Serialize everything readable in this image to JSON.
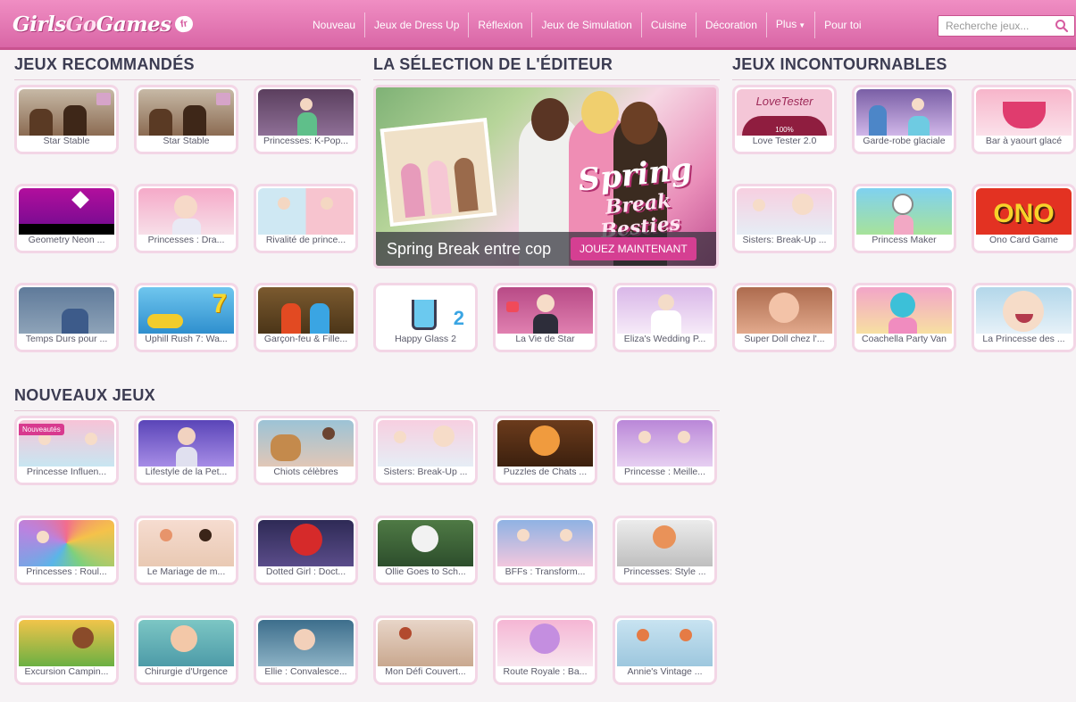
{
  "header": {
    "logo_part1": "Girls",
    "logo_part2": "Go",
    "logo_part3": "Games",
    "logo_badge": "fr",
    "nav": [
      {
        "label": "Nouveau"
      },
      {
        "label": "Jeux de Dress Up"
      },
      {
        "label": "Réflexion"
      },
      {
        "label": "Jeux de Simulation"
      },
      {
        "label": "Cuisine"
      },
      {
        "label": "Décoration"
      },
      {
        "label": "Plus"
      },
      {
        "label": "Pour toi"
      }
    ],
    "search_placeholder": "Recherche jeux..."
  },
  "sections": {
    "recommended": "JEUX RECOMMANDÉS",
    "editor": "LA SÉLECTION DE L'ÉDITEUR",
    "must_have": "JEUX INCONTOURNABLES",
    "new_games": "NOUVEAUX JEUX"
  },
  "featured": {
    "caption": "Spring Break entre cop",
    "cta": "JOUEZ MAINTENANT",
    "art_line1": "Spring",
    "art_line2": "Break",
    "art_line3": "Besties"
  },
  "recommended_games": [
    {
      "title": "Star Stable"
    },
    {
      "title": "Star Stable"
    },
    {
      "title": "Princesses: K-Pop..."
    },
    {
      "title": "Geometry Neon ..."
    },
    {
      "title": "Princesses : Dra..."
    },
    {
      "title": "Rivalité de prince..."
    },
    {
      "title": "Temps Durs pour ..."
    },
    {
      "title": "Uphill Rush 7: Wa..."
    },
    {
      "title": "Garçon-feu & Fille..."
    }
  ],
  "editor_games": [
    {
      "title": "Happy Glass 2"
    },
    {
      "title": "La Vie de Star"
    },
    {
      "title": "Eliza's Wedding P..."
    }
  ],
  "must_have_games": [
    {
      "title": "Love Tester 2.0",
      "art_text": "LoveTester",
      "art_pct": "100%"
    },
    {
      "title": "Garde-robe glaciale"
    },
    {
      "title": "Bar à yaourt glacé"
    },
    {
      "title": "Sisters: Break-Up ..."
    },
    {
      "title": "Princess Maker"
    },
    {
      "title": "Ono Card Game",
      "art_text": "ONO"
    },
    {
      "title": "Super Doll chez l'..."
    },
    {
      "title": "Coachella Party Van"
    },
    {
      "title": "La Princesse des ..."
    }
  ],
  "new_badge": "Nouveautés",
  "new_games": [
    {
      "title": "Princesse Influen..."
    },
    {
      "title": "Lifestyle de la Pet..."
    },
    {
      "title": "Chiots célèbres"
    },
    {
      "title": "Sisters: Break-Up ..."
    },
    {
      "title": "Puzzles de Chats ..."
    },
    {
      "title": "Princesse : Meille..."
    },
    {
      "title": "Princesses : Roul..."
    },
    {
      "title": "Le Mariage de m..."
    },
    {
      "title": "Dotted Girl : Doct..."
    },
    {
      "title": "Ollie Goes to Sch..."
    },
    {
      "title": "BFFs : Transform..."
    },
    {
      "title": "Princesses: Style ..."
    },
    {
      "title": "Excursion Campin..."
    },
    {
      "title": "Chirurgie d'Urgence"
    },
    {
      "title": "Ellie : Convalesce..."
    },
    {
      "title": "Mon Défi Couvert..."
    },
    {
      "title": "Route Royale : Ba..."
    },
    {
      "title": "Annie's Vintage ..."
    }
  ],
  "happy_glass_number": "2",
  "uphill_number": "7",
  "colors": {
    "brand_pink": "#e07ab5",
    "button_pink": "#d53f92",
    "title_text": "#3c3c52"
  }
}
